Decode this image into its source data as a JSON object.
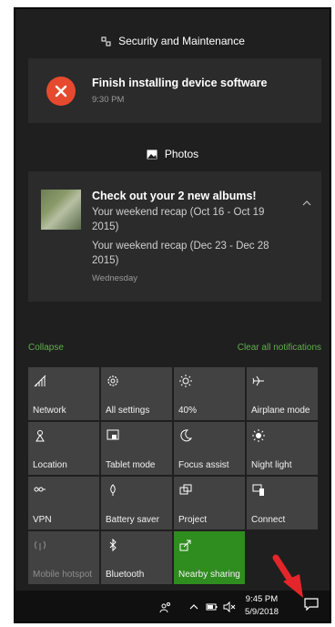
{
  "notifications": [
    {
      "app": "Security and Maintenance",
      "title": "Finish installing device software",
      "time": "9:30 PM"
    },
    {
      "app": "Photos",
      "title": "Check out your 2 new albums!",
      "lines": [
        "Your weekend recap (Oct 16 - Oct 19 2015)",
        "Your weekend recap (Dec 23 - Dec 28 2015)"
      ],
      "time": "Wednesday"
    }
  ],
  "actions": {
    "collapse": "Collapse",
    "clear_all": "Clear all notifications"
  },
  "tiles": [
    {
      "label": "Network",
      "icon": "network-icon"
    },
    {
      "label": "All settings",
      "icon": "gear-icon"
    },
    {
      "label": "40%",
      "icon": "brightness-icon"
    },
    {
      "label": "Airplane mode",
      "icon": "airplane-icon"
    },
    {
      "label": "Location",
      "icon": "location-icon"
    },
    {
      "label": "Tablet mode",
      "icon": "tablet-icon"
    },
    {
      "label": "Focus assist",
      "icon": "moon-icon"
    },
    {
      "label": "Night light",
      "icon": "sun-icon"
    },
    {
      "label": "VPN",
      "icon": "vpn-icon"
    },
    {
      "label": "Battery saver",
      "icon": "battery-saver-icon"
    },
    {
      "label": "Project",
      "icon": "project-icon"
    },
    {
      "label": "Connect",
      "icon": "connect-icon"
    },
    {
      "label": "Mobile hotspot",
      "icon": "hotspot-icon",
      "state": "disabled"
    },
    {
      "label": "Bluetooth",
      "icon": "bluetooth-icon"
    },
    {
      "label": "Nearby sharing",
      "icon": "share-icon",
      "state": "active"
    }
  ],
  "taskbar": {
    "time": "9:45 PM",
    "date": "5/9/2018"
  },
  "colors": {
    "accent_green": "#2f8c1f",
    "link_green": "#5fb04a",
    "error_red": "#e64a2e",
    "arrow_red": "#e3262a"
  }
}
